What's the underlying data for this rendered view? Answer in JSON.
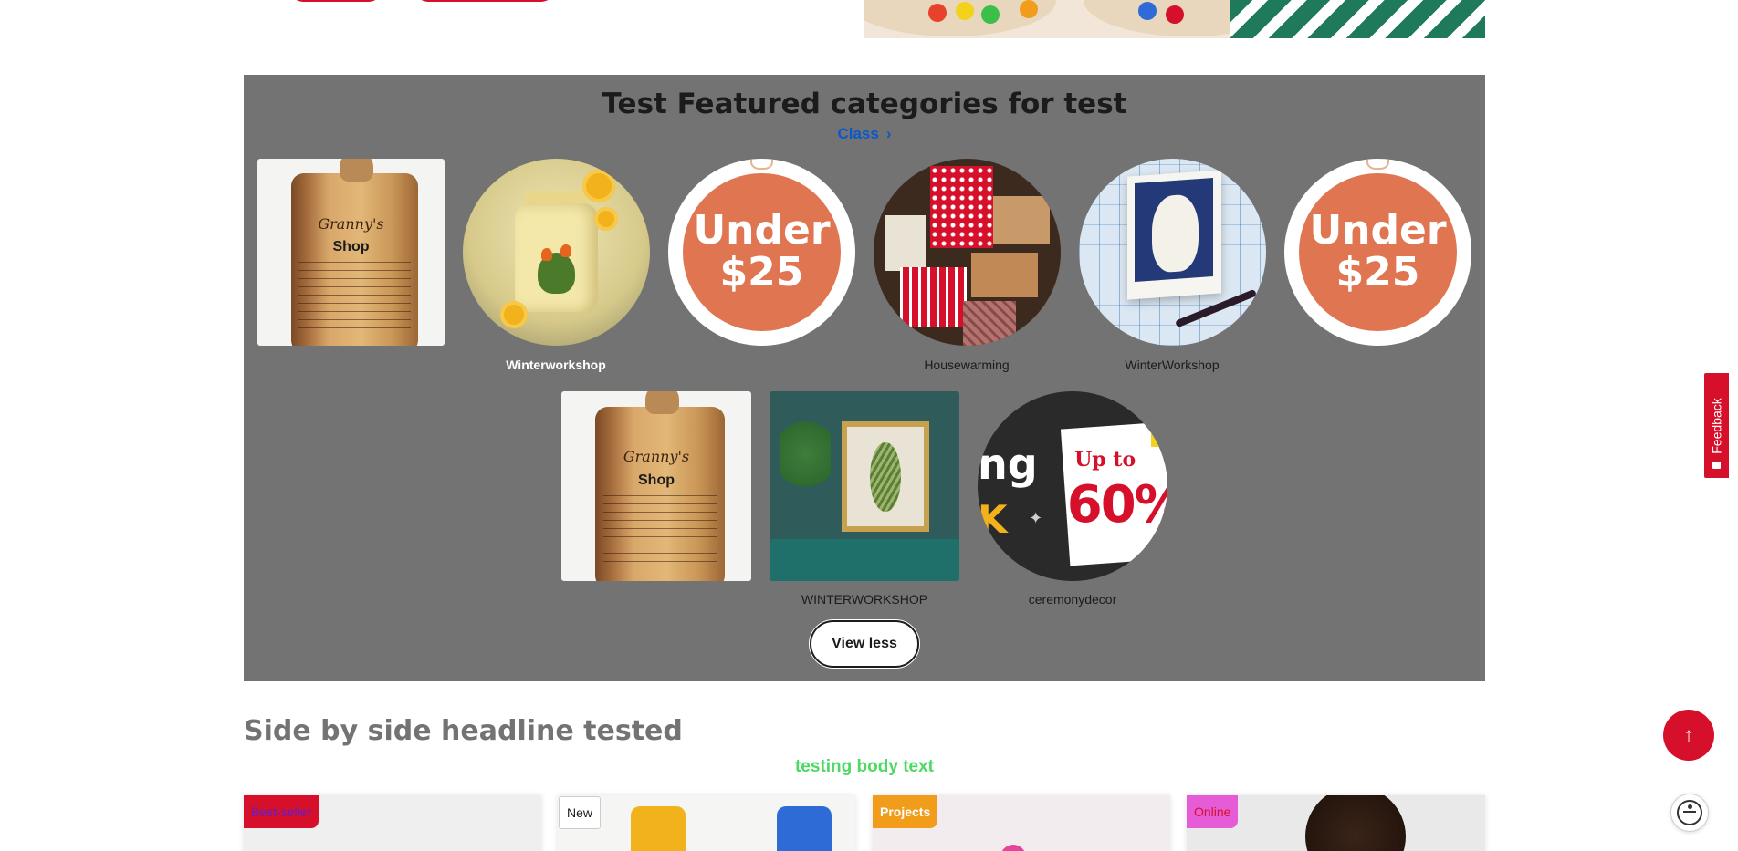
{
  "featured": {
    "title": "Test Featured categories for test",
    "link_label": "Class",
    "row1": [
      {
        "label": "",
        "image": "cutting-board-granny",
        "board_title": "Granny's",
        "board_shop": "Shop"
      },
      {
        "label": "Winterworkshop",
        "image": "yellow-jar-flowers"
      },
      {
        "label": "",
        "image": "under-25-badge",
        "line1": "Under",
        "line2": "$25"
      },
      {
        "label": "Housewarming",
        "image": "wrapped-gifts"
      },
      {
        "label": "WinterWorkshop",
        "image": "owl-card"
      },
      {
        "label": "",
        "image": "under-25-badge",
        "line1": "Under",
        "line2": "$25"
      }
    ],
    "row2": [
      {
        "label": "",
        "image": "cutting-board-granny",
        "board_title": "Granny's",
        "board_shop": "Shop"
      },
      {
        "label": "WINTERWORKSHOP",
        "image": "framed-plant-print"
      },
      {
        "label": "ceremonydecor",
        "image": "sale-graphic",
        "sale_text_1": "ng",
        "sale_text_2": "K",
        "sale_upto": "Up to",
        "sale_pct": "60%"
      }
    ],
    "view_less_label": "View less",
    "background_color": "#737373"
  },
  "side_by_side": {
    "title": "Side by side headline tested",
    "body": "testing body text",
    "body_color": "#4cd964",
    "cards": [
      {
        "badge": "Best-seller",
        "badge_bg": "#d6102b",
        "badge_color": "#5a1fd6"
      },
      {
        "badge": "New",
        "badge_bg": "#ffffff",
        "badge_color": "#1b1b1b"
      },
      {
        "badge": "Projects",
        "badge_bg": "#f29c1b",
        "badge_color": "#ffffff"
      },
      {
        "badge": "Online",
        "badge_bg": "#e55cd6",
        "badge_color": "#d6102b"
      }
    ]
  },
  "widgets": {
    "feedback_label": "Feedback",
    "back_to_top_icon": "arrow-up-icon",
    "accessibility_icon": "accessibility-icon"
  },
  "colors": {
    "brand_red": "#d6102b",
    "link_blue": "#0a58ca"
  }
}
